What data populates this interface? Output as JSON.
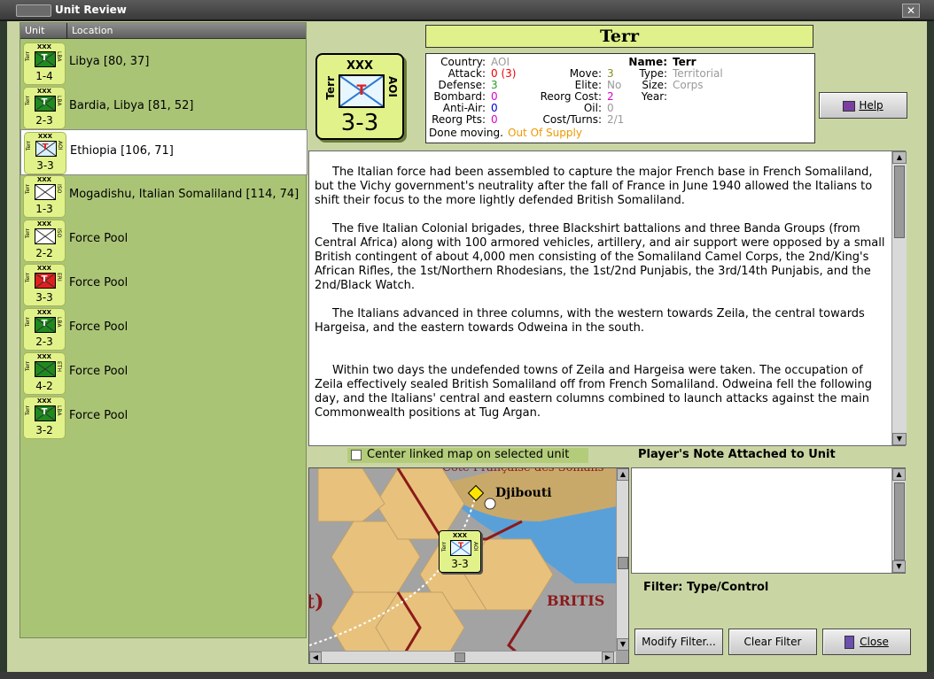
{
  "window": {
    "title": "Unit Review"
  },
  "list": {
    "col_unit": "Unit",
    "col_location": "Location",
    "rows": [
      {
        "location": "Libya [80, 37]",
        "side_left": "Terr",
        "side_right": "LBA",
        "strength": "1-4",
        "symbol_color": "#1f8a1f",
        "symbol_text": "T",
        "selected": false
      },
      {
        "location": "Bardia, Libya [81, 52]",
        "side_left": "Terr",
        "side_right": "LBA",
        "strength": "2-3",
        "symbol_color": "#1f8a1f",
        "symbol_text": "T",
        "selected": false
      },
      {
        "location": "Ethiopia [106, 71]",
        "side_left": "Terr",
        "side_right": "AOI",
        "strength": "3-3",
        "symbol_color": "#d8f0ff",
        "symbol_text": "T",
        "selected": true
      },
      {
        "location": "Mogadishu, Italian Somaliland [114, 74]",
        "side_left": "Terr",
        "side_right": "ISO",
        "strength": "1-3",
        "symbol_color": "#ffffff",
        "symbol_text": "",
        "selected": false
      },
      {
        "location": "Force Pool",
        "side_left": "Terr",
        "side_right": "ISO",
        "strength": "2-2",
        "symbol_color": "#ffffff",
        "symbol_text": "",
        "selected": false
      },
      {
        "location": "Force Pool",
        "side_left": "Terr",
        "side_right": "ERI",
        "strength": "3-3",
        "symbol_color": "#e02020",
        "symbol_text": "T",
        "selected": false
      },
      {
        "location": "Force Pool",
        "side_left": "Terr",
        "side_right": "LBA",
        "strength": "2-3",
        "symbol_color": "#1f8a1f",
        "symbol_text": "T",
        "selected": false
      },
      {
        "location": "Force Pool",
        "side_left": "Terr",
        "side_right": "ETH",
        "strength": "4-2",
        "symbol_color": "#1f8a1f",
        "symbol_text": "",
        "selected": false
      },
      {
        "location": "Force Pool",
        "side_left": "Terr",
        "side_right": "LBA",
        "strength": "3-2",
        "symbol_color": "#1f8a1f",
        "symbol_text": "T",
        "selected": false
      }
    ]
  },
  "unit": {
    "title": "Terr",
    "counter": {
      "size": "XXX",
      "side_left": "Terr",
      "side_right": "AOI",
      "symbol_text": "T",
      "strength": "3-3"
    },
    "stats": {
      "country_label": "Country:",
      "country": "AOI",
      "attack_label": "Attack:",
      "attack": "0 (3)",
      "defense_label": "Defense:",
      "defense": "3",
      "bombard_label": "Bombard:",
      "bombard": "0",
      "antiair_label": "Anti-Air:",
      "antiair": "0",
      "reorgpts_label": "Reorg Pts:",
      "reorgpts": "0",
      "done_label": "Done moving.",
      "done": "Out Of Supply",
      "move_label": "Move:",
      "move": "3",
      "elite_label": "Elite:",
      "elite": "No",
      "reorgcost_label": "Reorg Cost:",
      "reorgcost": "2",
      "oil_label": "Oil:",
      "oil": "0",
      "costturns_label": "Cost/Turns:",
      "costturns": "2/1",
      "name_label": "Name:",
      "name": "Terr",
      "type_label": "Type:",
      "type": "Territorial",
      "size_label": "Size:",
      "size": "Corps",
      "year_label": "Year:",
      "year": ""
    }
  },
  "buttons": {
    "help": "Help",
    "modify": "Modify Filter...",
    "clear": "Clear Filter",
    "close": "Close"
  },
  "description": [
    "The Italian force had been assembled to capture the major French base in French Somaliland, but the Vichy government's neutrality after the fall of France in June 1940 allowed the Italians to shift their focus to the more lightly defended British Somaliland.",
    "The five Italian Colonial brigades, three Blackshirt battalions and three Banda Groups (from Central Africa) along with 100 armored vehicles, artillery, and air support were opposed by a small British contingent of about 4,000 men consisting of the Somaliland Camel Corps, the 2nd/King's African Rifles, the 1st/Northern Rhodesians, the 1st/2nd Punjabis, the 3rd/14th Punjabis, and the 2nd/Black Watch.",
    "The Italians advanced in three columns, with the western towards Zeila, the central towards Hargeisa, and the eastern towards Odweina in the south.",
    "Within two days the undefended towns of Zeila and Hargeisa were taken.  The occupation of Zeila effectively sealed British Somaliland off from French Somaliland.  Odweina fell the following day, and the Italians' central and eastern columns combined to launch attacks against the main Commonwealth positions at Tug Argan."
  ],
  "center_checkbox": {
    "label": "Center linked map on selected unit",
    "checked": false
  },
  "note": {
    "header": "Player's Note Attached to Unit",
    "text": ""
  },
  "filter": {
    "text": "Filter:  Type/Control"
  },
  "map": {
    "city_label": "Djibouti",
    "region_label": "BRITIS",
    "top_label": "Côte Française des Somalis",
    "left_fragment": "t)",
    "counter": {
      "size": "XXX",
      "side_left": "Terr",
      "side_right": "AOI",
      "symbol_text": "T",
      "strength": "3-3"
    }
  }
}
